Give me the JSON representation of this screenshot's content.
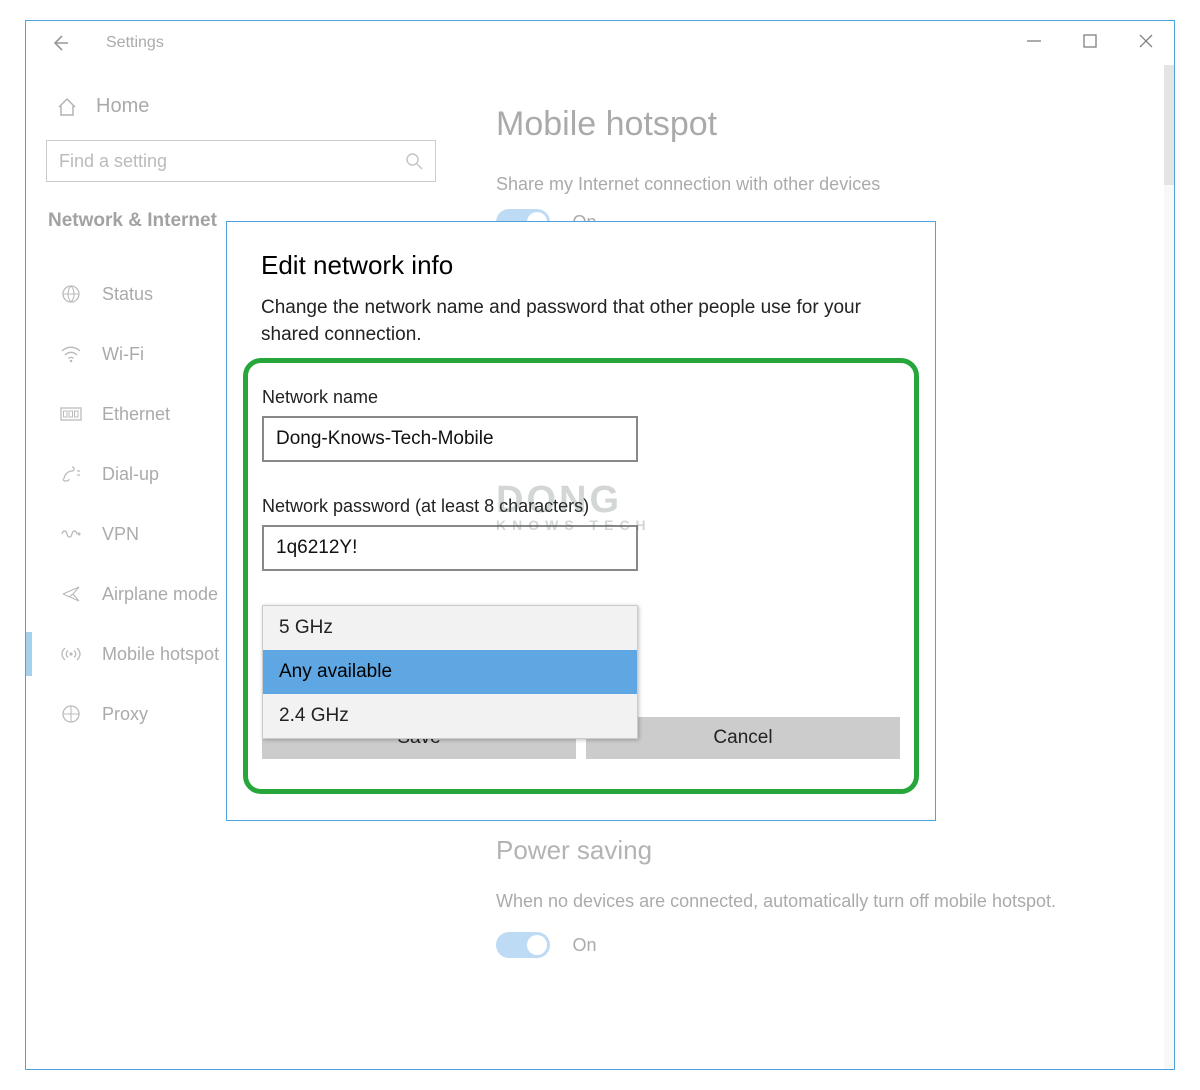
{
  "window": {
    "title": "Settings"
  },
  "sidebar": {
    "home": "Home",
    "search_placeholder": "Find a setting",
    "section": "Network & Internet",
    "items": [
      {
        "label": "Status"
      },
      {
        "label": "Wi-Fi"
      },
      {
        "label": "Ethernet"
      },
      {
        "label": "Dial-up"
      },
      {
        "label": "VPN"
      },
      {
        "label": "Airplane mode"
      },
      {
        "label": "Mobile hotspot"
      },
      {
        "label": "Proxy"
      }
    ]
  },
  "main": {
    "heading": "Mobile hotspot",
    "share_label": "Share my Internet connection with other devices",
    "share_state": "On",
    "power": {
      "heading": "Power saving",
      "desc": "When no devices are connected, automatically turn off mobile hotspot.",
      "state": "On"
    }
  },
  "dialog": {
    "title": "Edit network info",
    "desc": "Change the network name and password that other people use for your shared connection.",
    "network_name_label": "Network name",
    "network_name_value": "Dong-Knows-Tech-Mobile",
    "password_label": "Network password (at least 8 characters)",
    "password_value": "1q6212Y!",
    "band_options": [
      "5 GHz",
      "Any available",
      "2.4 GHz"
    ],
    "band_selected": "Any available",
    "save": "Save",
    "cancel": "Cancel"
  },
  "watermark": {
    "top": "DONG",
    "sub": "KNOWS TECH"
  }
}
